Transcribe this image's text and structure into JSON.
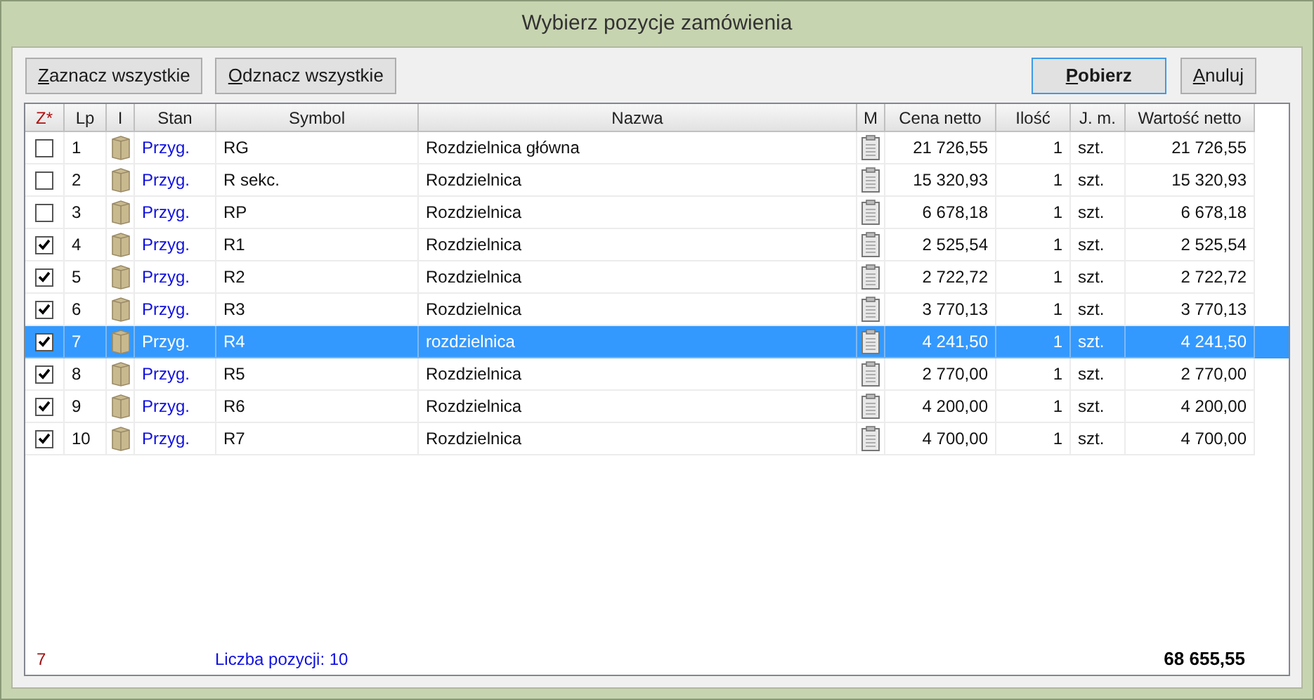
{
  "window": {
    "title": "Wybierz pozycje zamówienia"
  },
  "left_buttons": [
    {
      "label": "Zaznacz wszystkie",
      "default": false
    },
    {
      "label": "Odznacz wszystkie",
      "default": false
    }
  ],
  "right_buttons": [
    {
      "label": "Pobierz",
      "default": true
    },
    {
      "label": "Anuluj",
      "default": false
    }
  ],
  "table": {
    "columns": [
      "Z*",
      "Lp",
      "I",
      "Stan",
      "Symbol",
      "Nazwa",
      "M",
      "Cena netto",
      "Ilość",
      "J. m.",
      "Wartość netto"
    ],
    "rows": [
      {
        "checked": false,
        "selected": false,
        "lp": "1",
        "stan": "Przyg.",
        "symbol": "RG",
        "nazwa": "Rozdzielnica główna",
        "cena": "21 726,55",
        "ilosc": "1",
        "jm": "szt.",
        "wartosc": "21 726,55"
      },
      {
        "checked": false,
        "selected": false,
        "lp": "2",
        "stan": "Przyg.",
        "symbol": "R sekc.",
        "nazwa": "Rozdzielnica",
        "cena": "15 320,93",
        "ilosc": "1",
        "jm": "szt.",
        "wartosc": "15 320,93"
      },
      {
        "checked": false,
        "selected": false,
        "lp": "3",
        "stan": "Przyg.",
        "symbol": "RP",
        "nazwa": "Rozdzielnica",
        "cena": "6 678,18",
        "ilosc": "1",
        "jm": "szt.",
        "wartosc": "6 678,18"
      },
      {
        "checked": true,
        "selected": false,
        "lp": "4",
        "stan": "Przyg.",
        "symbol": "R1",
        "nazwa": "Rozdzielnica",
        "cena": "2 525,54",
        "ilosc": "1",
        "jm": "szt.",
        "wartosc": "2 525,54"
      },
      {
        "checked": true,
        "selected": false,
        "lp": "5",
        "stan": "Przyg.",
        "symbol": "R2",
        "nazwa": "Rozdzielnica",
        "cena": "2 722,72",
        "ilosc": "1",
        "jm": "szt.",
        "wartosc": "2 722,72"
      },
      {
        "checked": true,
        "selected": false,
        "lp": "6",
        "stan": "Przyg.",
        "symbol": "R3",
        "nazwa": "Rozdzielnica",
        "cena": "3 770,13",
        "ilosc": "1",
        "jm": "szt.",
        "wartosc": "3 770,13"
      },
      {
        "checked": true,
        "selected": true,
        "lp": "7",
        "stan": "Przyg.",
        "symbol": "R4",
        "nazwa": "rozdzielnica",
        "cena": "4 241,50",
        "ilosc": "1",
        "jm": "szt.",
        "wartosc": "4 241,50"
      },
      {
        "checked": true,
        "selected": false,
        "lp": "8",
        "stan": "Przyg.",
        "symbol": "R5",
        "nazwa": "Rozdzielnica",
        "cena": "2 770,00",
        "ilosc": "1",
        "jm": "szt.",
        "wartosc": "2 770,00"
      },
      {
        "checked": true,
        "selected": false,
        "lp": "9",
        "stan": "Przyg.",
        "symbol": "R6",
        "nazwa": "Rozdzielnica",
        "cena": "4 200,00",
        "ilosc": "1",
        "jm": "szt.",
        "wartosc": "4 200,00"
      },
      {
        "checked": true,
        "selected": false,
        "lp": "10",
        "stan": "Przyg.",
        "symbol": "R7",
        "nazwa": "Rozdzielnica",
        "cena": "4 700,00",
        "ilosc": "1",
        "jm": "szt.",
        "wartosc": "4 700,00"
      }
    ]
  },
  "footer": {
    "checked_count": "7",
    "positions": "Liczba pozycji: 10",
    "total": "68 655,55"
  }
}
